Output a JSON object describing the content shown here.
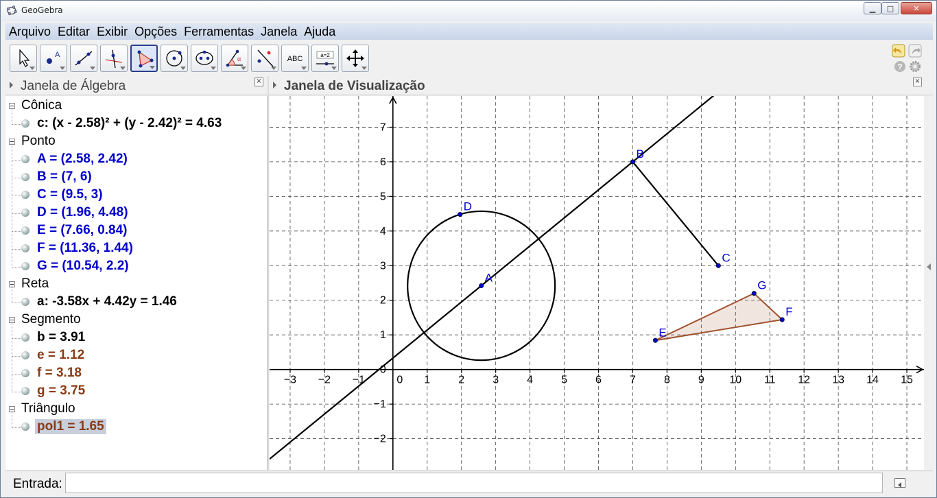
{
  "window": {
    "title": "GeoGebra"
  },
  "menu": [
    "Arquivo",
    "Editar",
    "Exibir",
    "Opções",
    "Ferramentas",
    "Janela",
    "Ajuda"
  ],
  "toolbar": {
    "tools": [
      "move",
      "point",
      "line",
      "perpendicular-line",
      "polygon",
      "circle",
      "conic",
      "angle",
      "reflect",
      "text",
      "slider",
      "move-graphics"
    ],
    "selected": "polygon",
    "text_tool_label": "ABC",
    "slider_tool_label": "a=2"
  },
  "algebra": {
    "title": "Janela de Álgebra",
    "categories": [
      {
        "label": "Cônica",
        "items": [
          {
            "text": "c: (x - 2.58)² + (y - 2.42)² = 4.63",
            "color": "#000000"
          }
        ]
      },
      {
        "label": "Ponto",
        "items": [
          {
            "text": "A = (2.58, 2.42)",
            "color": "#0000cc"
          },
          {
            "text": "B = (7, 6)",
            "color": "#0000cc"
          },
          {
            "text": "C = (9.5, 3)",
            "color": "#0000cc"
          },
          {
            "text": "D = (1.96, 4.48)",
            "color": "#0000cc"
          },
          {
            "text": "E = (7.66, 0.84)",
            "color": "#0000cc"
          },
          {
            "text": "F = (11.36, 1.44)",
            "color": "#0000cc"
          },
          {
            "text": "G = (10.54, 2.2)",
            "color": "#0000cc"
          }
        ]
      },
      {
        "label": "Reta",
        "items": [
          {
            "text": "a: -3.58x + 4.42y = 1.46",
            "color": "#000000"
          }
        ]
      },
      {
        "label": "Segmento",
        "items": [
          {
            "text": "b = 3.91",
            "color": "#000000"
          },
          {
            "text": "e = 1.12",
            "color": "#8a3a14"
          },
          {
            "text": "f = 3.18",
            "color": "#8a3a14"
          },
          {
            "text": "g = 3.75",
            "color": "#8a3a14"
          }
        ]
      },
      {
        "label": "Triângulo",
        "items": [
          {
            "text": "pol1 = 1.65",
            "color": "#8a3a14",
            "selected": true
          }
        ]
      }
    ]
  },
  "graphics": {
    "title": "Janela de Visualização",
    "xlim": [
      -3.6,
      15.5
    ],
    "ylim": [
      -2.9,
      7.9
    ],
    "xticks": [
      -3,
      -2,
      -1,
      0,
      1,
      2,
      3,
      4,
      5,
      6,
      7,
      8,
      9,
      10,
      11,
      12,
      13,
      14,
      15
    ],
    "yticks": [
      -2,
      -1,
      0,
      1,
      2,
      3,
      4,
      5,
      6,
      7
    ],
    "grid": true,
    "points": [
      {
        "name": "A",
        "x": 2.58,
        "y": 2.42
      },
      {
        "name": "B",
        "x": 7,
        "y": 6
      },
      {
        "name": "C",
        "x": 9.5,
        "y": 3
      },
      {
        "name": "D",
        "x": 1.96,
        "y": 4.48
      },
      {
        "name": "E",
        "x": 7.66,
        "y": 0.84
      },
      {
        "name": "F",
        "x": 11.36,
        "y": 1.44
      },
      {
        "name": "G",
        "x": 10.54,
        "y": 2.2
      }
    ],
    "circle": {
      "cx": 2.58,
      "cy": 2.42,
      "r": 2.152
    },
    "line": {
      "a": -3.58,
      "b": 4.42,
      "c": 1.46
    },
    "segment": [
      "B",
      "C"
    ],
    "triangle": [
      "E",
      "F",
      "G"
    ],
    "point_color": "#0000cc",
    "triangle_color": "#a0522d"
  },
  "input": {
    "label": "Entrada:",
    "value": ""
  }
}
